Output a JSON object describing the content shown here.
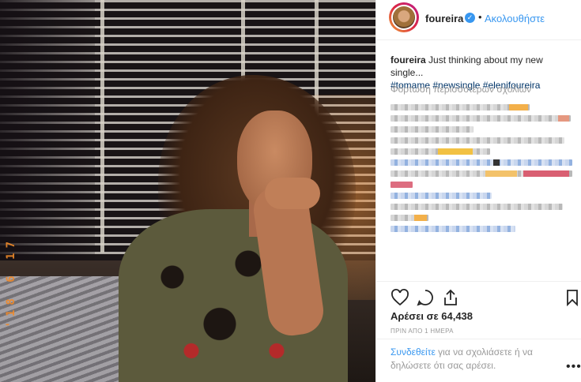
{
  "post": {
    "photo": {
      "alt_icon": "post-photo",
      "datestamp": "'18 6 17"
    },
    "header": {
      "username": "foureira",
      "verified_icon": "verified-badge-icon",
      "separator": "•",
      "follow_label": "Ακολουθήστε"
    },
    "caption": {
      "username": "foureira",
      "text": "Just thinking about my new single...",
      "hashtags": [
        "#tomame",
        "#newsingle",
        "#eleni​foureira"
      ]
    },
    "load_more": "Φόρτωση περισσότερων σχολίων",
    "comments_count_visible": 12,
    "actions": {
      "like_icon": "heart-icon",
      "comment_icon": "comment-icon",
      "share_icon": "share-icon",
      "save_icon": "bookmark-icon"
    },
    "likes_text": "Αρέσει σε 64,438",
    "timestamp": "ΠΡΙΝ ΑΠΟ 1 ΗΜΕΡΑ",
    "login": {
      "link": "Συνδεθείτε",
      "rest": " για να σχολιάσετε ή να δηλώσετε ότι σας αρέσει."
    },
    "more_icon": "more-options-icon",
    "colors": {
      "accent": "#3897f0",
      "text": "#262626",
      "muted": "#999999",
      "hashtag": "#003569"
    }
  }
}
